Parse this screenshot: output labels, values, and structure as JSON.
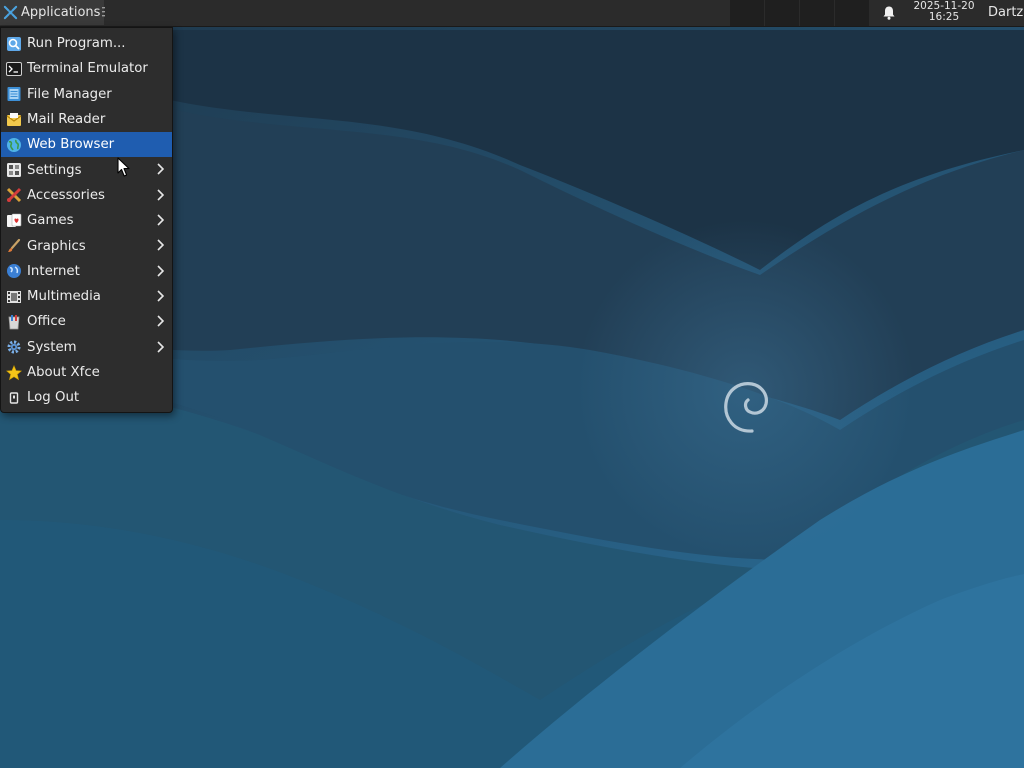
{
  "panel": {
    "applications_label": "Applications",
    "clock_date": "2025-11-20",
    "clock_time": "16:25",
    "user_name": "Dartz",
    "notification_icon": "bell-icon"
  },
  "menu": {
    "items": [
      {
        "label": "Run Program...",
        "icon": "run-program-icon",
        "submenu": false
      },
      {
        "label": "Terminal Emulator",
        "icon": "terminal-icon",
        "submenu": false
      },
      {
        "label": "File Manager",
        "icon": "file-manager-icon",
        "submenu": false
      },
      {
        "label": "Mail Reader",
        "icon": "mail-icon",
        "submenu": false
      },
      {
        "label": "Web Browser",
        "icon": "web-browser-icon",
        "submenu": false,
        "highlighted": true
      },
      {
        "label": "Settings",
        "icon": "settings-icon",
        "submenu": true
      },
      {
        "label": "Accessories",
        "icon": "accessories-icon",
        "submenu": true
      },
      {
        "label": "Games",
        "icon": "games-icon",
        "submenu": true
      },
      {
        "label": "Graphics",
        "icon": "graphics-icon",
        "submenu": true
      },
      {
        "label": "Internet",
        "icon": "internet-icon",
        "submenu": true
      },
      {
        "label": "Multimedia",
        "icon": "multimedia-icon",
        "submenu": true
      },
      {
        "label": "Office",
        "icon": "office-icon",
        "submenu": true
      },
      {
        "label": "System",
        "icon": "system-icon",
        "submenu": true
      },
      {
        "label": "About Xfce",
        "icon": "star-icon",
        "submenu": false
      },
      {
        "label": "Log Out",
        "icon": "log-out-icon",
        "submenu": false
      }
    ]
  },
  "colors": {
    "panel_bg": "#2b2b2b",
    "menu_bg": "#2d2d2d",
    "menu_highlight": "#1f5db0",
    "wallpaper_dark": "#1c3447",
    "wallpaper_light": "#2a6a93"
  }
}
